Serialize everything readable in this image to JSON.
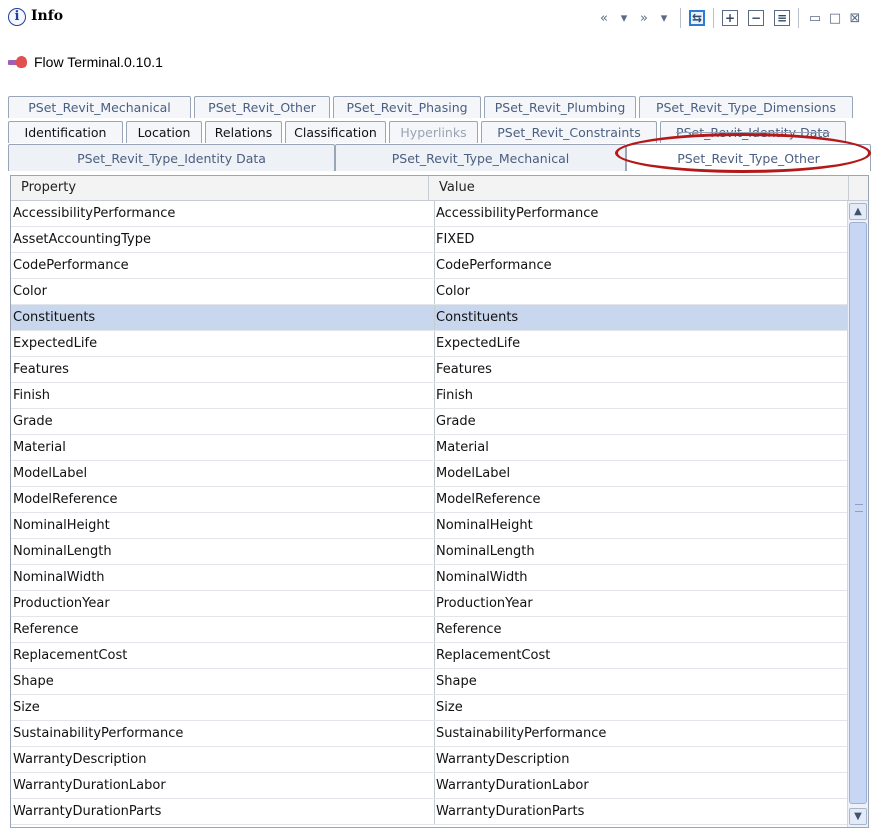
{
  "panel": {
    "title": "Info",
    "info_icon_glyph": "i",
    "element_label": "Flow Terminal.0.10.1"
  },
  "toolbar": {
    "back_glyph": "«",
    "dropdown_glyph": "▾",
    "forward_glyph": "»",
    "link_glyph": "⇆",
    "expand_glyph": "+",
    "collapse_glyph": "−",
    "equal_glyph": "≡",
    "minimize_glyph": "▭",
    "maximize_glyph": "□",
    "close_glyph": "⊠"
  },
  "tabs": {
    "row1": [
      "PSet_Revit_Mechanical",
      "PSet_Revit_Other",
      "PSet_Revit_Phasing",
      "PSet_Revit_Plumbing",
      "PSet_Revit_Type_Dimensions"
    ],
    "row2": [
      "Identification",
      "Location",
      "Relations",
      "Classification",
      "Hyperlinks",
      "PSet_Revit_Constraints",
      "PSet_Revit_Identity Data"
    ],
    "row3": [
      "PSet_Revit_Type_Identity Data",
      "PSet_Revit_Type_Mechanical",
      "PSet_Revit_Type_Other"
    ],
    "selected": "PSet_Revit_Type_Other"
  },
  "table": {
    "headers": {
      "property": "Property",
      "value": "Value"
    },
    "rows": [
      {
        "property": "AccessibilityPerformance",
        "value": "AccessibilityPerformance"
      },
      {
        "property": "AssetAccountingType",
        "value": "FIXED"
      },
      {
        "property": "CodePerformance",
        "value": "CodePerformance"
      },
      {
        "property": "Color",
        "value": "Color"
      },
      {
        "property": "Constituents",
        "value": "Constituents"
      },
      {
        "property": "ExpectedLife",
        "value": "ExpectedLife"
      },
      {
        "property": "Features",
        "value": "Features"
      },
      {
        "property": "Finish",
        "value": "Finish"
      },
      {
        "property": "Grade",
        "value": "Grade"
      },
      {
        "property": "Material",
        "value": "Material"
      },
      {
        "property": "ModelLabel",
        "value": "ModelLabel"
      },
      {
        "property": "ModelReference",
        "value": "ModelReference"
      },
      {
        "property": "NominalHeight",
        "value": "NominalHeight"
      },
      {
        "property": "NominalLength",
        "value": "NominalLength"
      },
      {
        "property": "NominalWidth",
        "value": "NominalWidth"
      },
      {
        "property": "ProductionYear",
        "value": "ProductionYear"
      },
      {
        "property": "Reference",
        "value": "Reference"
      },
      {
        "property": "ReplacementCost",
        "value": "ReplacementCost"
      },
      {
        "property": "Shape",
        "value": "Shape"
      },
      {
        "property": "Size",
        "value": "Size"
      },
      {
        "property": "SustainabilityPerformance",
        "value": "SustainabilityPerformance"
      },
      {
        "property": "WarrantyDescription",
        "value": "WarrantyDescription"
      },
      {
        "property": "WarrantyDurationLabor",
        "value": "WarrantyDurationLabor"
      },
      {
        "property": "WarrantyDurationParts",
        "value": "WarrantyDurationParts"
      }
    ],
    "selected_row": "Constituents"
  },
  "scrollbar": {
    "up_glyph": "▲",
    "down_glyph": "▼"
  },
  "colors": {
    "selection": "#c9d7ee",
    "highlight_ellipse": "#b41818",
    "tab_text": "#4a5f80"
  }
}
